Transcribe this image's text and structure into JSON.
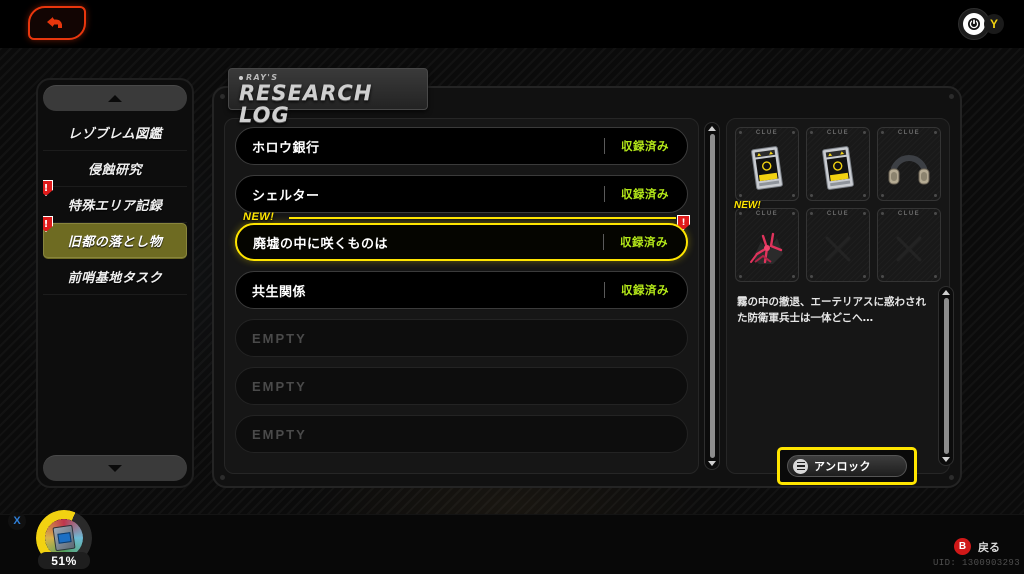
{
  "topbar": {
    "back_icon": "back-arrow-icon",
    "power_icon": "power-icon",
    "y_button": "Y"
  },
  "header": {
    "subtitle": "RAY'S",
    "title": "RESEARCH LOG"
  },
  "sidebar": {
    "scroll_up": "scroll-up-arrow",
    "scroll_down": "scroll-down-arrow",
    "items": [
      {
        "label": "レゾブレム図鑑",
        "selected": false,
        "alert": false
      },
      {
        "label": "侵蝕研究",
        "selected": false,
        "alert": false
      },
      {
        "label": "特殊エリア記録",
        "selected": false,
        "alert": true
      },
      {
        "label": "旧都の落とし物",
        "selected": true,
        "alert": true
      },
      {
        "label": "前哨基地タスク",
        "selected": false,
        "alert": false
      }
    ]
  },
  "list": {
    "status_recorded": "収録済み",
    "empty_label": "EMPTY",
    "new_badge": "NEW!",
    "rows": [
      {
        "name": "ホロウ銀行",
        "status": "収録済み",
        "empty": false,
        "active": false,
        "is_new": false
      },
      {
        "name": "シェルター",
        "status": "収録済み",
        "empty": false,
        "active": false,
        "is_new": false
      },
      {
        "name": "廃墟の中に咲くものは",
        "status": "収録済み",
        "empty": false,
        "active": true,
        "is_new": true
      },
      {
        "name": "共生関係",
        "status": "収録済み",
        "empty": false,
        "active": false,
        "is_new": false
      },
      {
        "name": "EMPTY",
        "status": "",
        "empty": true,
        "active": false,
        "is_new": false
      },
      {
        "name": "EMPTY",
        "status": "",
        "empty": true,
        "active": false,
        "is_new": false
      },
      {
        "name": "EMPTY",
        "status": "",
        "empty": true,
        "active": false,
        "is_new": false
      }
    ]
  },
  "detail": {
    "clue_tag": "CLUE",
    "new_badge": "NEW!",
    "description": "霧の中の撤退、エーテリアスに惑わされた防衛軍兵士は一体どこへ…",
    "clues": [
      {
        "icon": "tablet-device-icon",
        "locked": false,
        "is_new": false
      },
      {
        "icon": "tablet-device-icon",
        "locked": false,
        "is_new": false
      },
      {
        "icon": "headphones-icon",
        "locked": false,
        "is_new": false
      },
      {
        "icon": "red-creature-icon",
        "locked": false,
        "is_new": true
      },
      {
        "icon": "locked-cross-icon",
        "locked": true,
        "is_new": false
      },
      {
        "icon": "locked-cross-icon",
        "locked": true,
        "is_new": false
      }
    ]
  },
  "unlock": {
    "label": "アンロック",
    "icon": "menu-hamburger-icon"
  },
  "hud": {
    "progress_percent": "51%",
    "x_button": "X",
    "b_button": "B",
    "back_label": "戻る",
    "uid": "UID: 1300903293"
  }
}
